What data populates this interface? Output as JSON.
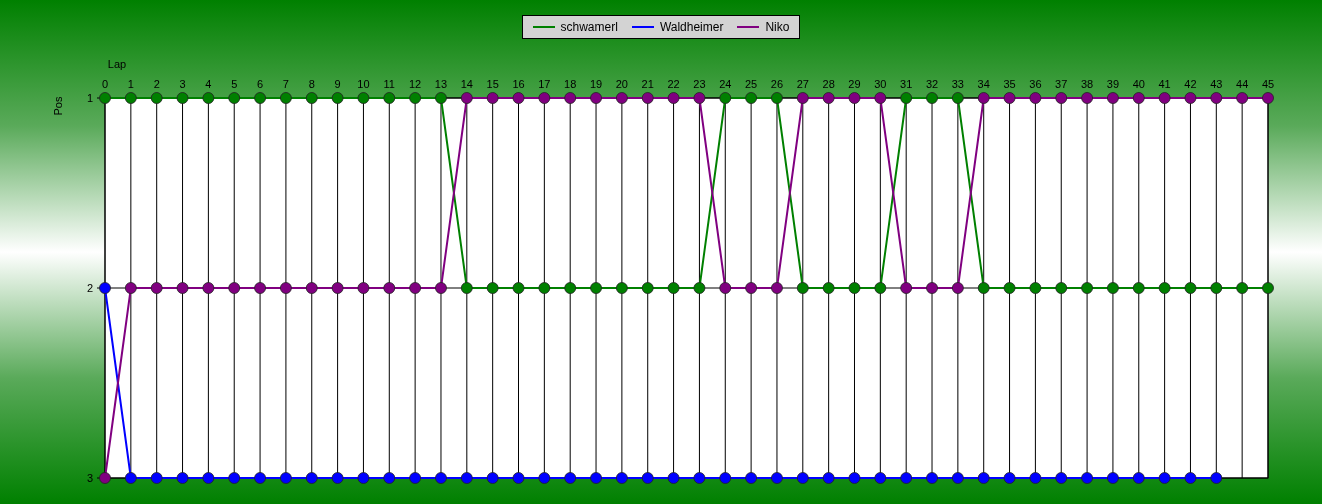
{
  "chart_data": {
    "type": "line",
    "xlabel": "Lap",
    "ylabel": "Pos",
    "x": [
      0,
      1,
      2,
      3,
      4,
      5,
      6,
      7,
      8,
      9,
      10,
      11,
      12,
      13,
      14,
      15,
      16,
      17,
      18,
      19,
      20,
      21,
      22,
      23,
      24,
      25,
      26,
      27,
      28,
      29,
      30,
      31,
      32,
      33,
      34,
      35,
      36,
      37,
      38,
      39,
      40,
      41,
      42,
      43,
      44,
      45
    ],
    "xticks": [
      0,
      1,
      2,
      3,
      4,
      5,
      6,
      7,
      8,
      9,
      10,
      11,
      12,
      13,
      14,
      15,
      16,
      17,
      18,
      19,
      20,
      21,
      22,
      23,
      24,
      25,
      26,
      27,
      28,
      29,
      30,
      31,
      32,
      33,
      34,
      35,
      36,
      37,
      38,
      39,
      40,
      41,
      42,
      43,
      44,
      45
    ],
    "grid": true,
    "xlim": [
      0,
      45
    ],
    "ylim": [
      3,
      1
    ],
    "yticks": [
      1,
      2,
      3
    ],
    "series": [
      {
        "name": "schwamerl",
        "color": "#008000",
        "marker": "circle",
        "values": [
          1,
          1,
          1,
          1,
          1,
          1,
          1,
          1,
          1,
          1,
          1,
          1,
          1,
          1,
          2,
          2,
          2,
          2,
          2,
          2,
          2,
          2,
          2,
          2,
          1,
          1,
          1,
          2,
          2,
          2,
          2,
          1,
          1,
          1,
          2,
          2,
          2,
          2,
          2,
          2,
          2,
          2,
          2,
          2,
          2,
          2
        ]
      },
      {
        "name": "Waldheimer",
        "color": "#0000ff",
        "marker": "circle",
        "values": [
          2,
          3,
          3,
          3,
          3,
          3,
          3,
          3,
          3,
          3,
          3,
          3,
          3,
          3,
          3,
          3,
          3,
          3,
          3,
          3,
          3,
          3,
          3,
          3,
          3,
          3,
          3,
          3,
          3,
          3,
          3,
          3,
          3,
          3,
          3,
          3,
          3,
          3,
          3,
          3,
          3,
          3,
          3,
          3,
          null,
          null
        ]
      },
      {
        "name": "Niko",
        "color": "#800080",
        "marker": "circle",
        "values": [
          3,
          2,
          2,
          2,
          2,
          2,
          2,
          2,
          2,
          2,
          2,
          2,
          2,
          2,
          1,
          1,
          1,
          1,
          1,
          1,
          1,
          1,
          1,
          1,
          2,
          2,
          2,
          1,
          1,
          1,
          1,
          2,
          2,
          2,
          1,
          1,
          1,
          1,
          1,
          1,
          1,
          1,
          1,
          1,
          1,
          1
        ]
      }
    ]
  }
}
